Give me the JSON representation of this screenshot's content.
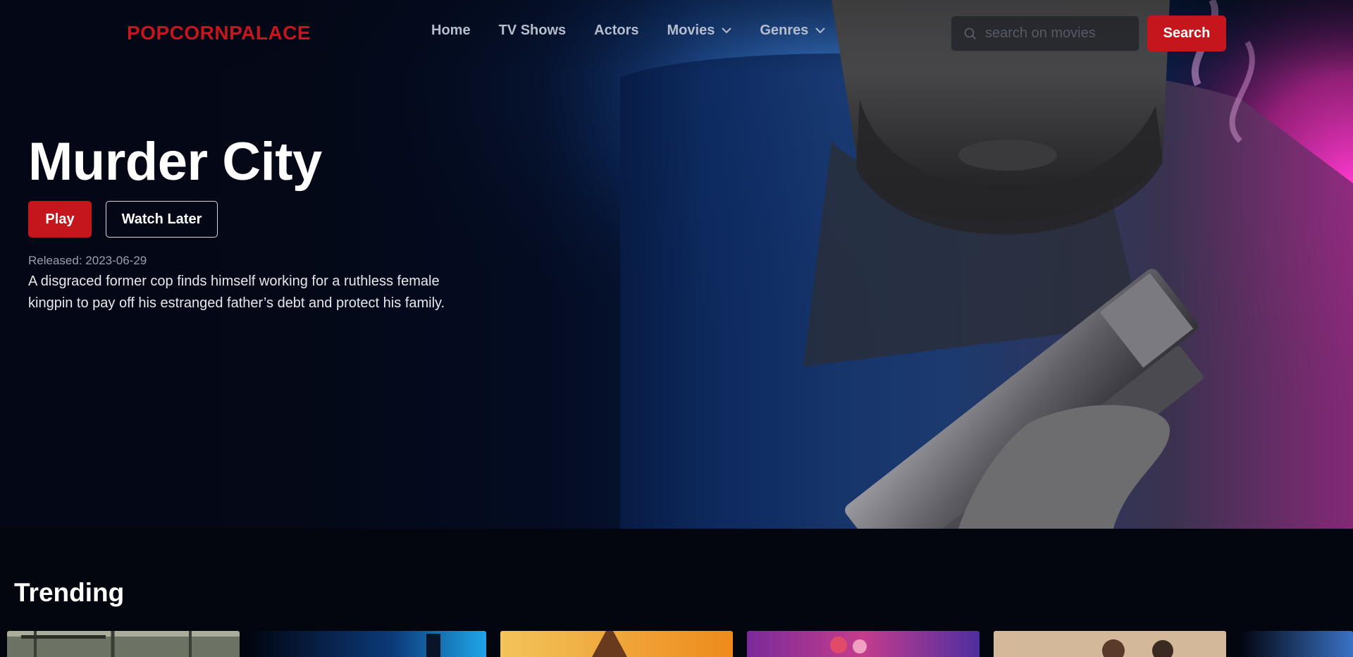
{
  "navbar": {
    "logo": "POPCORNPALACE",
    "links": [
      {
        "label": "Home",
        "dropdown": false
      },
      {
        "label": "TV Shows",
        "dropdown": false
      },
      {
        "label": "Actors",
        "dropdown": false
      },
      {
        "label": "Movies",
        "dropdown": true
      },
      {
        "label": "Genres",
        "dropdown": true
      }
    ],
    "search": {
      "placeholder": "search on movies",
      "value": "",
      "icon": "search-icon",
      "button_label": "Search"
    }
  },
  "hero": {
    "title": "Murder City",
    "play_label": "Play",
    "watch_later_label": "Watch Later",
    "released_label": "Released:",
    "released_date": "2023-06-29",
    "overview": "A disgraced former cop finds himself working for a ruthless female kingpin to pay off his estranged father’s debt and protect his family."
  },
  "trending": {
    "title": "Trending",
    "cards": [
      "card-1",
      "card-2",
      "card-3",
      "card-4",
      "card-5",
      "card-6"
    ]
  },
  "colors": {
    "brand_red": "#c4161c",
    "background": "#03050f",
    "nav_text": "#b6bdcc"
  }
}
